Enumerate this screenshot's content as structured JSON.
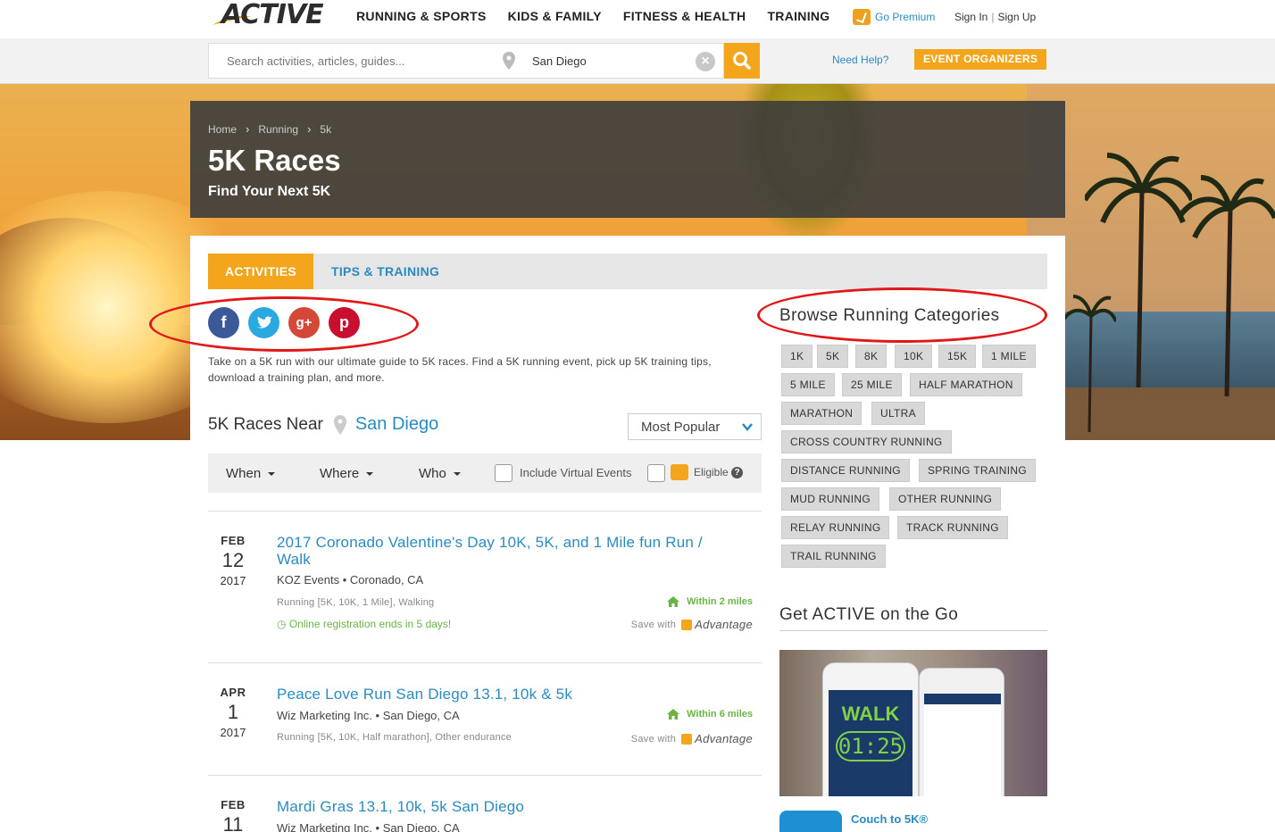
{
  "header": {
    "logo_text": "ACTIVE",
    "nav": [
      "RUNNING & SPORTS",
      "KIDS & FAMILY",
      "FITNESS & HEALTH",
      "TRAINING"
    ],
    "go_premium": "Go Premium",
    "sign_in": "Sign In",
    "sign_up": "Sign Up"
  },
  "search": {
    "placeholder": "Search activities, articles, guides...",
    "location": "San Diego",
    "clear_glyph": "×",
    "need_help": "Need Help?",
    "event_organizers": "EVENT ORGANIZERS"
  },
  "hero": {
    "breadcrumbs": [
      "Home",
      "Running",
      "5k"
    ],
    "title": "5K Races",
    "subtitle": "Find Your Next 5K"
  },
  "tabs": [
    "ACTIVITIES",
    "TIPS & TRAINING"
  ],
  "social": [
    "f",
    "t",
    "g+",
    "p"
  ],
  "intro": "Take on a 5K run with our ultimate guide to 5K races. Find a 5K running event, pick up 5K training tips, download a training plan, and more.",
  "results": {
    "label": "5K Races Near",
    "city": "San Diego",
    "sort": "Most Popular",
    "filters": [
      "When",
      "Where",
      "Who"
    ],
    "virtual_label": "Include Virtual Events",
    "eligible_label": "Eligible",
    "help_glyph": "?"
  },
  "events": [
    {
      "month": "FEB",
      "day": "12",
      "year": "2017",
      "title": "2017 Coronado Valentine's Day 10K, 5K, and 1 Mile fun Run / Walk",
      "organizer": "KOZ Events • Coronado, CA",
      "category": "Running [5K, 10K, 1 Mile], Walking",
      "registration": "Online registration ends in 5 days!",
      "distance": "Within 2 miles",
      "save_label": "Save with",
      "advantage": "Advantage"
    },
    {
      "month": "APR",
      "day": "1",
      "year": "2017",
      "title": "Peace Love Run San Diego 13.1, 10k & 5k",
      "organizer": "Wiz Marketing Inc. • San Diego, CA",
      "category": "Running [5K, 10K, Half marathon], Other endurance",
      "distance": "Within 6 miles",
      "save_label": "Save with",
      "advantage": "Advantage"
    },
    {
      "month": "FEB",
      "day": "11",
      "year": "",
      "title": "Mardi Gras 13.1, 10k, 5k San Diego",
      "organizer": "Wiz Marketing Inc. • San Diego, CA"
    }
  ],
  "sidebar": {
    "browse_title": "Browse Running Categories",
    "categories": [
      "1K",
      "5K",
      "8K",
      "10K",
      "15K",
      "1 MILE",
      "5 MILE",
      "25 MILE",
      "HALF MARATHON",
      "MARATHON",
      "ULTRA",
      "CROSS COUNTRY RUNNING",
      "DISTANCE RUNNING",
      "SPRING TRAINING",
      "MUD RUNNING",
      "OTHER RUNNING",
      "RELAY RUNNING",
      "TRACK RUNNING",
      "TRAIL RUNNING"
    ],
    "go_title": "Get ACTIVE on the Go",
    "app_walk": "WALK",
    "app_timer": "01:25",
    "app_name": "Couch to 5K®"
  },
  "colors": {
    "brand_orange": "#f3a51c",
    "link_blue": "#2a8bc0",
    "green": "#6ab446",
    "annotation_red": "#e01818"
  }
}
